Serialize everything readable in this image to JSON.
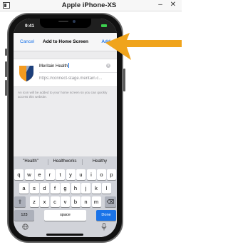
{
  "window": {
    "title": "Apple iPhone-XS",
    "controls": "– ✕"
  },
  "status": {
    "time": "9:41"
  },
  "nav": {
    "cancel": "Cancel",
    "title": "Add to Home Screen",
    "add": "Add"
  },
  "bookmark": {
    "name": "Meritain Health",
    "url": "https://connect-stage.meritain.c...",
    "info": "An icon will be added to your home screen so you can quickly access this website."
  },
  "keyboard": {
    "suggestions": [
      "\"Health\"",
      "Healthworks",
      "Healthy"
    ],
    "row1": [
      "q",
      "w",
      "e",
      "r",
      "t",
      "y",
      "u",
      "i",
      "o",
      "p"
    ],
    "row2": [
      "a",
      "s",
      "d",
      "f",
      "g",
      "h",
      "j",
      "k",
      "l"
    ],
    "row3": [
      "z",
      "x",
      "c",
      "v",
      "b",
      "n",
      "m"
    ],
    "numbers_key": "123",
    "space_key": "space",
    "done_key": "Done"
  },
  "colors": {
    "accent": "#1a73e8",
    "arrow": "#f0a41c",
    "battery": "#3ccf4e",
    "logo_orange": "#f39a1f",
    "logo_navy": "#1d3f7a"
  },
  "icons": [
    "sim-window-icon",
    "shift-icon",
    "backspace-icon",
    "globe-icon",
    "microphone-icon",
    "clear-icon"
  ]
}
